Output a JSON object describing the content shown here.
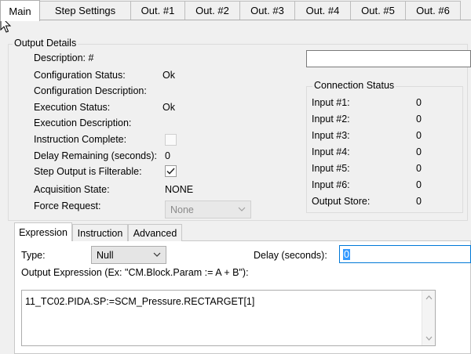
{
  "tabs": [
    "Main",
    "Step Settings",
    "Out. #1",
    "Out. #2",
    "Out. #3",
    "Out. #4",
    "Out. #5",
    "Out. #6"
  ],
  "output_details": {
    "title": "Output Details",
    "description_label": "Description: #",
    "config_status_label": "Configuration Status:",
    "config_status_value": "Ok",
    "config_description_label": "Configuration Description:",
    "exec_status_label": "Execution Status:",
    "exec_status_value": "Ok",
    "exec_description_label": "Execution Description:",
    "instruction_complete_label": "Instruction Complete:",
    "instruction_complete_checked": false,
    "delay_remaining_label": "Delay Remaining (seconds):",
    "delay_remaining_value": "0",
    "step_filterable_label": "Step Output is Filterable:",
    "step_filterable_checked": true,
    "acquisition_state_label": "Acquisition State:",
    "acquisition_state_value": "NONE",
    "force_request_label": "Force Request:",
    "force_request_value": "None"
  },
  "connection_status": {
    "title": "Connection Status",
    "rows": [
      {
        "label": "Input #1:",
        "value": "0"
      },
      {
        "label": "Input #2:",
        "value": "0"
      },
      {
        "label": "Input #3:",
        "value": "0"
      },
      {
        "label": "Input #4:",
        "value": "0"
      },
      {
        "label": "Input #5:",
        "value": "0"
      },
      {
        "label": "Input #6:",
        "value": "0"
      },
      {
        "label": "Output Store:",
        "value": "0"
      }
    ]
  },
  "bottom_tabs": [
    "Expression",
    "Instruction",
    "Advanced"
  ],
  "expression": {
    "type_label": "Type:",
    "type_value": "Null",
    "delay_label": "Delay (seconds):",
    "delay_value": "0",
    "output_expression_label": "Output Expression (Ex: \"CM.Block.Param := A + B\"):",
    "output_expression_value": "11_TC02.PIDA.SP:=SCM_Pressure.RECTARGET[1]"
  }
}
